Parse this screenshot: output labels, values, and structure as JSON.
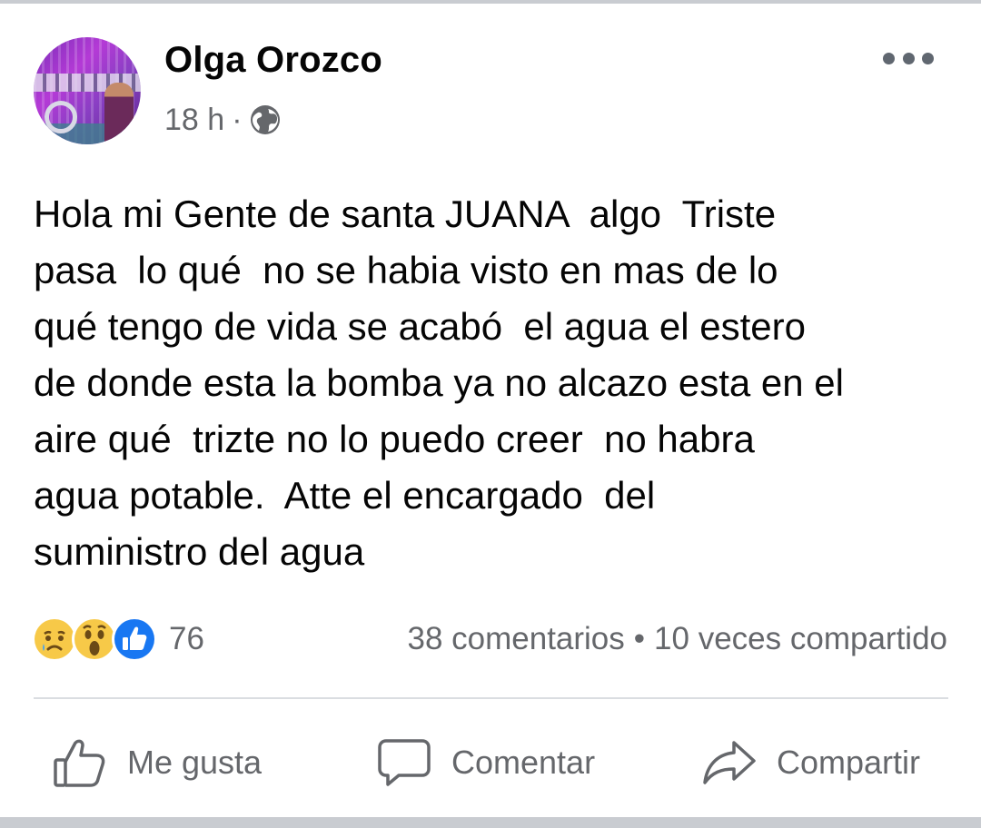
{
  "post": {
    "author": "Olga Orozco",
    "time": "18 h",
    "meta_separator": "·",
    "privacy_icon": "globe-icon",
    "body": "Hola mi Gente de santa JUANA  algo  Triste\npasa  lo qué  no se habia visto en mas de lo\nqué tengo de vida se acabó  el agua el estero\nde donde esta la bomba ya no alcazo esta en el\naire qué  trizte no lo puedo creer  no habra\nagua potable.  Atte el encargado  del\nsuministro del agua"
  },
  "reactions": {
    "icons": [
      "sad-emoji-icon",
      "wow-emoji-icon",
      "like-reaction-icon"
    ],
    "count": "76"
  },
  "stats": {
    "comments": "38 comentarios",
    "separator": "•",
    "shares": "10 veces compartido"
  },
  "actions": {
    "like_label": "Me gusta",
    "comment_label": "Comentar",
    "share_label": "Compartir"
  },
  "colors": {
    "text_primary": "#050505",
    "text_secondary": "#65676b",
    "like_blue": "#1877f2",
    "emoji_yellow": "#f7c948",
    "divider": "#dadde1"
  }
}
